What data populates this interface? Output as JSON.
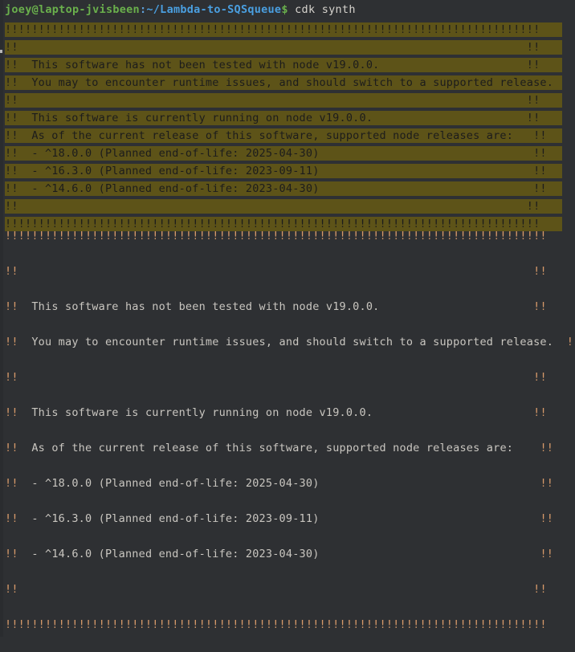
{
  "terminal": {
    "background_color": "#2e3033",
    "prompt": {
      "user_host": "joey@laptop-jvisbeen",
      "separator": ":",
      "path": "~/Lambda-to-SQSqueue",
      "symbol": "$",
      "command": " cdk synth",
      "user_host_color": "#6ab04c",
      "path_color": "#4a9fe0"
    },
    "highlighted_block": {
      "background_color": "#5d5318",
      "text_color": "#1c1c1c",
      "lines": [
        "!!!!!!!!!!!!!!!!!!!!!!!!!!!!!!!!!!!!!!!!!!!!!!!!!!!!!!!!!!!!!!!!!!!!!!!!!!!!!!!!",
        "!!                                                                            !!",
        "!!  This software has not been tested with node v19.0.0.                      !!",
        "!!  You may to encounter runtime issues, and should switch to a supported release.  !!",
        "!!                                                                            !!",
        "!!  This software is currently running on node v19.0.0.                       !!",
        "!!  As of the current release of this software, supported node releases are:   !!",
        "!!  - ^18.0.0 (Planned end-of-life: 2025-04-30)                                !!",
        "!!  - ^16.3.0 (Planned end-of-life: 2023-09-11)                                !!",
        "!!  - ^14.6.0 (Planned end-of-life: 2023-04-30)                                !!",
        "!!                                                                            !!",
        "!!!!!!!!!!!!!!!!!!!!!!!!!!!!!!!!!!!!!!!!!!!!!!!!!!!!!!!!!!!!!!!!!!!!!!!!!!!!!!!!"
      ]
    },
    "plain_block": {
      "text_color": "#c9c6c0",
      "bang_color": "#d79a6a",
      "lines": [
        "!!!!!!!!!!!!!!!!!!!!!!!!!!!!!!!!!!!!!!!!!!!!!!!!!!!!!!!!!!!!!!!!!!!!!!!!!!!!!!!!!",
        "!!                                                                             !!",
        "!!  This software has not been tested with node v19.0.0.                       !!",
        "!!  You may to encounter runtime issues, and should switch to a supported release.  !!",
        "!!                                                                             !!",
        "!!  This software is currently running on node v19.0.0.                        !!",
        "!!  As of the current release of this software, supported node releases are:    !!",
        "!!  - ^18.0.0 (Planned end-of-life: 2025-04-30)                                 !!",
        "!!  - ^16.3.0 (Planned end-of-life: 2023-09-11)                                 !!",
        "!!  - ^14.6.0 (Planned end-of-life: 2023-04-30)                                 !!",
        "!!                                                                             !!",
        "!!!!!!!!!!!!!!!!!!!!!!!!!!!!!!!!!!!!!!!!!!!!!!!!!!!!!!!!!!!!!!!!!!!!!!!!!!!!!!!!!"
      ]
    }
  }
}
